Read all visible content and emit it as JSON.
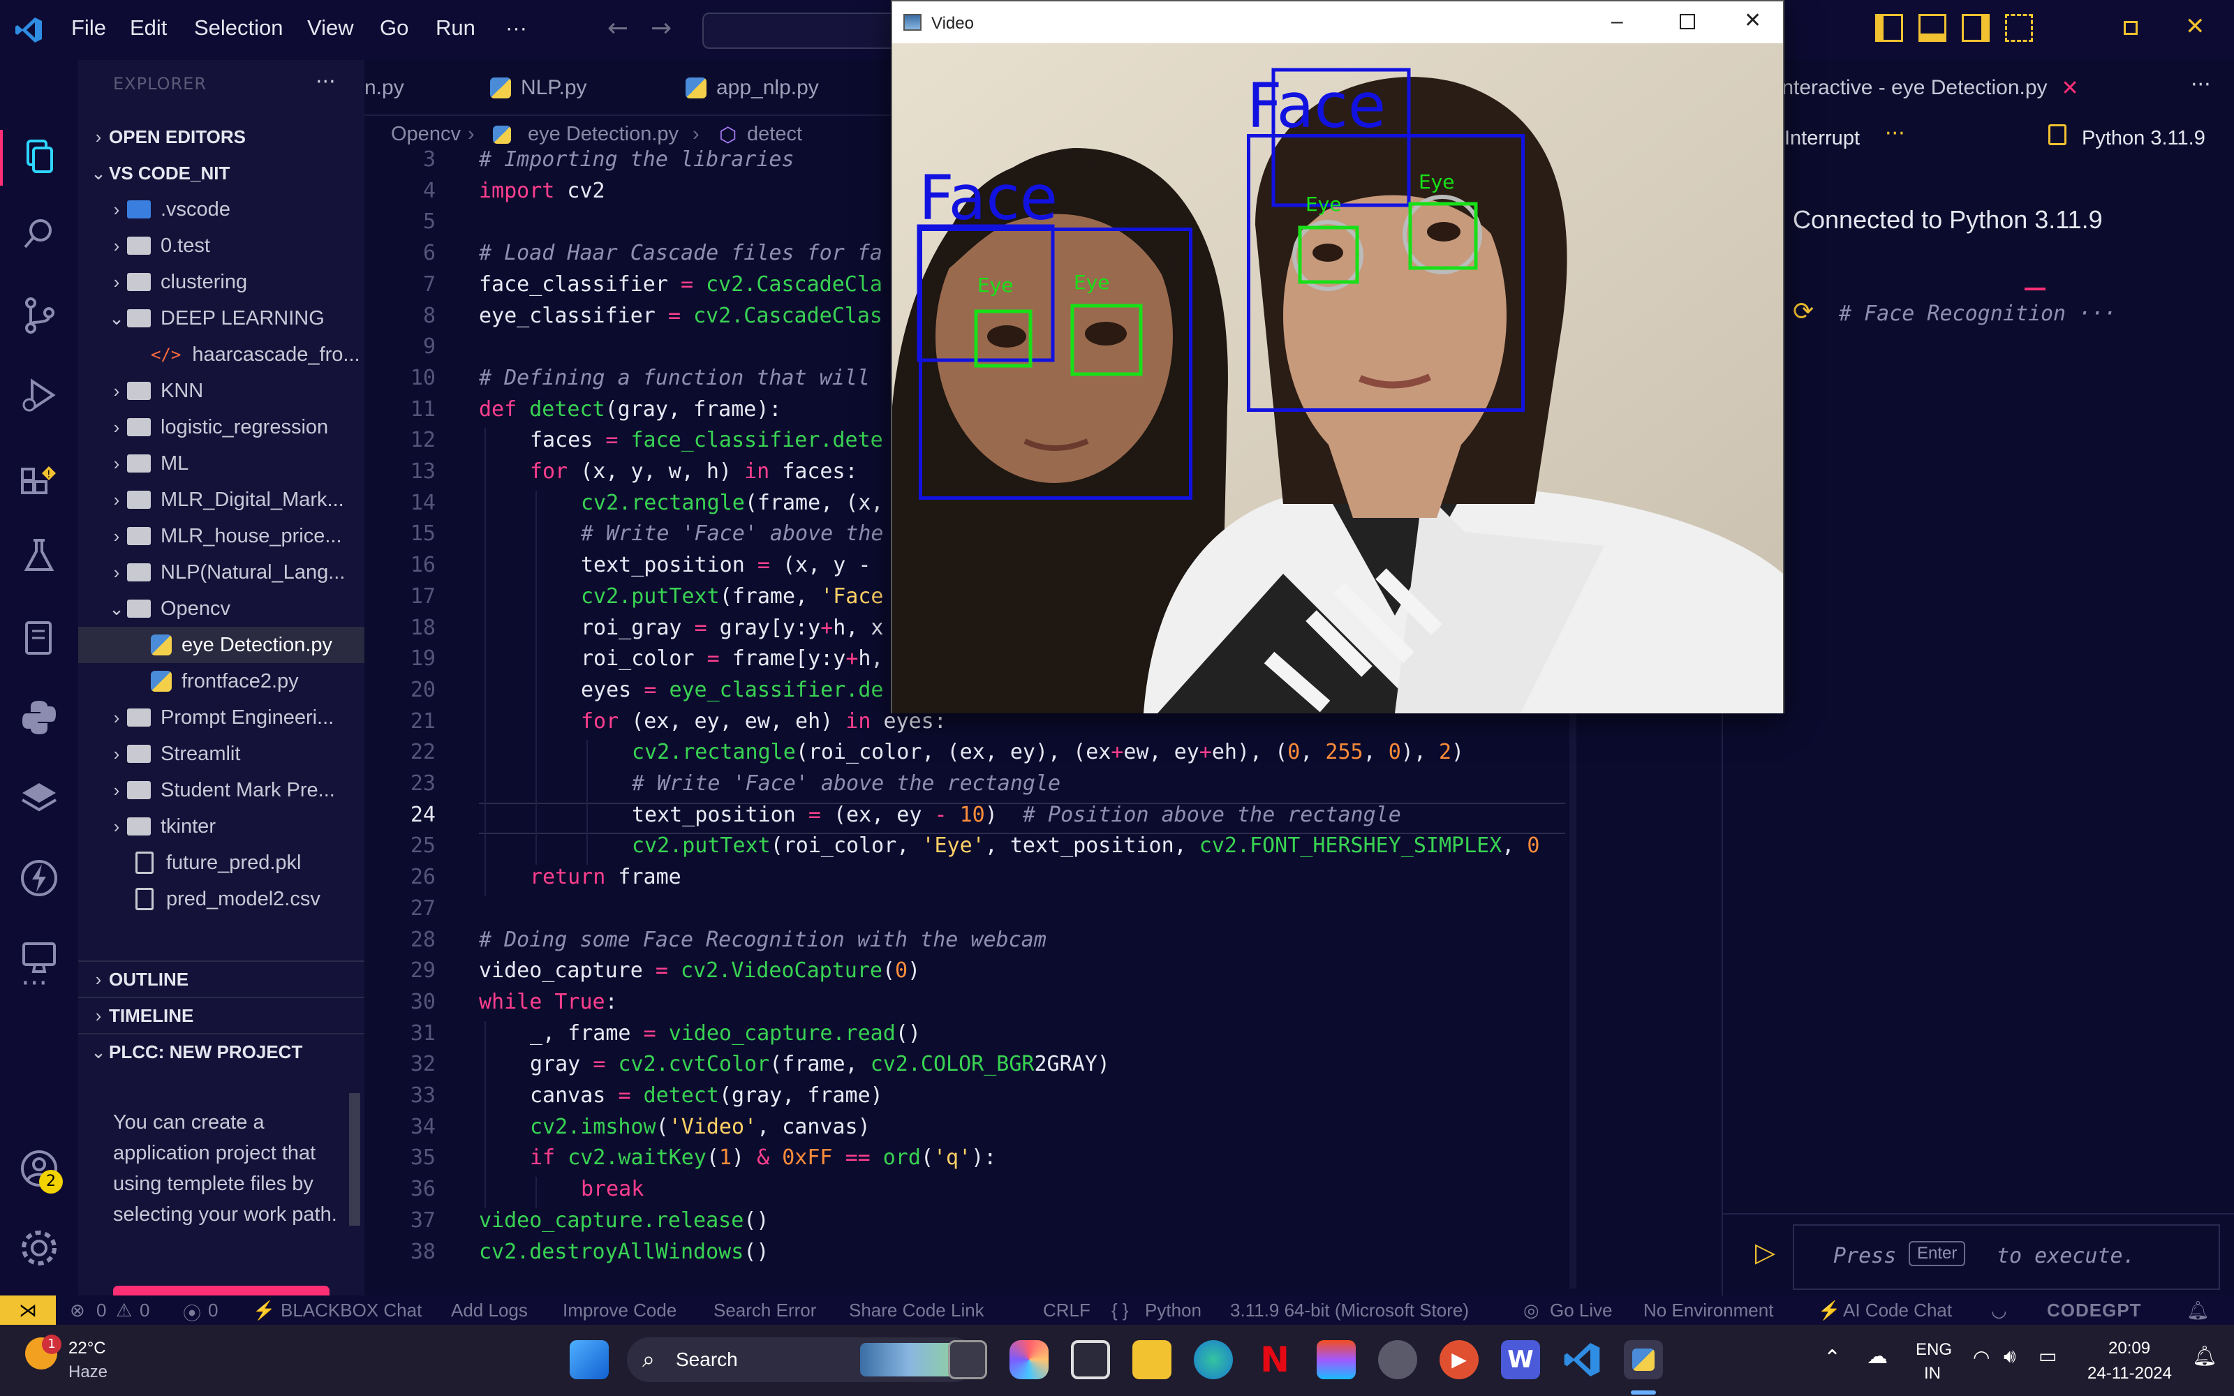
{
  "menu": {
    "file": "File",
    "edit": "Edit",
    "selection": "Selection",
    "view": "View",
    "go": "Go",
    "run": "Run",
    "more": "···"
  },
  "sidebar": {
    "header": "EXPLORER",
    "more": "···",
    "open_editors": "OPEN EDITORS",
    "workspace": "VS CODE_NIT",
    "items": [
      ".vscode",
      "0.test",
      "clustering",
      "DEEP LEARNING",
      "haarcascade_fro...",
      "KNN",
      "logistic_regression",
      "ML",
      "MLR_Digital_Mark...",
      "MLR_house_price...",
      "NLP(Natural_Lang...",
      "Opencv",
      "eye Detection.py",
      "frontface2.py",
      "Prompt Engineeri...",
      "Streamlit",
      "Student Mark Pre...",
      "tkinter",
      "future_pred.pkl",
      "pred_model2.csv"
    ],
    "outline": "OUTLINE",
    "timeline": "TIMELINE",
    "plcc": "PLCC: NEW PROJECT",
    "plcc_text": "You can create a application project that using templete files by selecting your work path."
  },
  "tabs": [
    "n.py",
    "NLP.py",
    "app_nlp.py",
    "Interactive - eye Detection.py"
  ],
  "breadcrumb": {
    "folder": "Opencv",
    "file": "eye Detection.py",
    "symbol": "detect"
  },
  "code_lines": [
    {
      "n": "3",
      "t": "# Importing the libraries"
    },
    {
      "n": "4",
      "t": "import cv2"
    },
    {
      "n": "5",
      "t": ""
    },
    {
      "n": "6",
      "t": "# Load Haar Cascade files for fa"
    },
    {
      "n": "7",
      "t": "face_classifier = cv2.CascadeCla"
    },
    {
      "n": "8",
      "t": "eye_classifier = cv2.CascadeClas"
    },
    {
      "n": "9",
      "t": ""
    },
    {
      "n": "10",
      "t": "# Defining a function that will"
    },
    {
      "n": "11",
      "t": "def detect(gray, frame):"
    },
    {
      "n": "12",
      "t": "faces = face_classifier.dete"
    },
    {
      "n": "13",
      "t": "for (x, y, w, h) in faces:"
    },
    {
      "n": "14",
      "t": "cv2.rectangle(frame, (x,"
    },
    {
      "n": "15",
      "t": "# Write 'Face' above the"
    },
    {
      "n": "16",
      "t": "text_position = (x, y -"
    },
    {
      "n": "17",
      "t": "cv2.putText(frame, 'Face"
    },
    {
      "n": "18",
      "t": "roi_gray = gray[y:y+h, x"
    },
    {
      "n": "19",
      "t": "roi_color = frame[y:y+h,"
    },
    {
      "n": "20",
      "t": "eyes = eye_classifier.de"
    },
    {
      "n": "21",
      "t": "for (ex, ey, ew, eh) in eyes:"
    },
    {
      "n": "22",
      "t": "cv2.rectangle(roi_color, (ex, ey), (ex+ew, ey+eh), (0, 255, 0), 2)"
    },
    {
      "n": "23",
      "t": "# Write 'Face' above the rectangle"
    },
    {
      "n": "24",
      "t": "text_position = (ex, ey - 10)  # Position above the rectangle"
    },
    {
      "n": "25",
      "t": "cv2.putText(roi_color, 'Eye', text_position, cv2.FONT_HERSHEY_SIMPLEX, 0"
    },
    {
      "n": "26",
      "t": "return frame"
    },
    {
      "n": "27",
      "t": ""
    },
    {
      "n": "28",
      "t": "# Doing some Face Recognition with the webcam"
    },
    {
      "n": "29",
      "t": "video_capture = cv2.VideoCapture(0)"
    },
    {
      "n": "30",
      "t": "while True:"
    },
    {
      "n": "31",
      "t": "_, frame = video_capture.read()"
    },
    {
      "n": "32",
      "t": "gray = cv2.cvtColor(frame, cv2.COLOR_BGR2GRAY)"
    },
    {
      "n": "33",
      "t": "canvas = detect(gray, frame)"
    },
    {
      "n": "34",
      "t": "cv2.imshow('Video', canvas)"
    },
    {
      "n": "35",
      "t": "if cv2.waitKey(1) & 0xFF == ord('q'):"
    },
    {
      "n": "36",
      "t": "break"
    },
    {
      "n": "37",
      "t": "video_capture.release()"
    },
    {
      "n": "38",
      "t": "cv2.destroyAllWindows()"
    }
  ],
  "right_panel": {
    "interrupt": "Interrupt",
    "more": "···",
    "kernel": "Python 3.11.9",
    "connected": "Connected to Python 3.11.9",
    "cell_preview": "# Face Recognition ···",
    "input_press": "Press",
    "input_key": "Enter",
    "input_rest": "to execute."
  },
  "video": {
    "title": "Video",
    "face_label": "Face",
    "eye_label": "Eye"
  },
  "status": {
    "errors": "0",
    "warnings": "0",
    "ports": "0",
    "blackbox": "BLACKBOX Chat",
    "add_logs": "Add Logs",
    "improve": "Improve Code",
    "search_error": "Search Error",
    "share": "Share Code Link",
    "eol": "CRLF",
    "lang": "Python",
    "interp": "3.11.9 64-bit (Microsoft Store)",
    "golive": "Go Live",
    "env": "No Environment",
    "aichat": "AI Code Chat",
    "codegpt": "CODEGPT"
  },
  "taskbar": {
    "temp": "22°C",
    "weather": "Haze",
    "weather_badge": "1",
    "search": "Search",
    "lang1": "ENG",
    "lang2": "IN",
    "time": "20:09",
    "date": "24-11-2024"
  },
  "activity": {
    "account_badge": "2"
  }
}
